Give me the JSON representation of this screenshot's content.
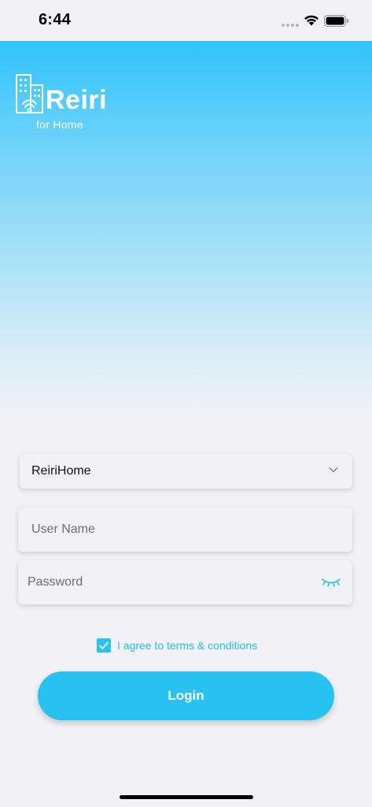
{
  "status_bar": {
    "time": "6:44"
  },
  "logo": {
    "word": "Reiri",
    "subtitle": "for Home"
  },
  "form": {
    "site_select": {
      "selected": "ReiriHome"
    },
    "username": {
      "placeholder": "User Name"
    },
    "password": {
      "placeholder": "Password"
    },
    "terms": {
      "label": "I agree to terms & conditions",
      "checked": true
    },
    "login_label": "Login"
  },
  "colors": {
    "accent": "#27c2ef",
    "gradient_top": "#2fc3fb",
    "background": "#f2f2f6"
  },
  "icons": [
    "wifi-icon",
    "battery-icon",
    "building-wifi-icon",
    "chevron-down-icon",
    "eye-closed-icon",
    "checkmark-icon"
  ]
}
